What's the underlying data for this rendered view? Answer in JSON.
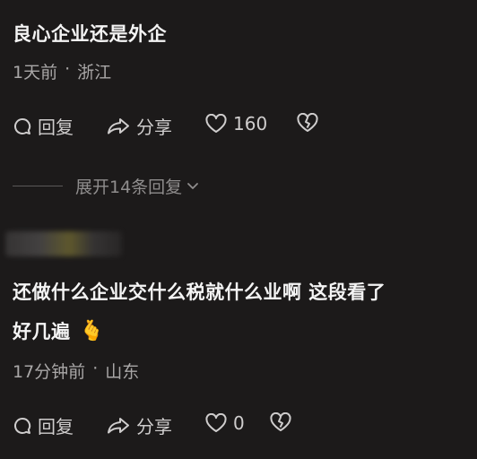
{
  "comment1": {
    "text": "良心企业还是外企",
    "time": "1天前",
    "separator": "·",
    "location": "浙江",
    "reply_label": "回复",
    "share_label": "分享",
    "like_count": "160"
  },
  "expand": {
    "label": "展开14条回复"
  },
  "comment2": {
    "text_line1": "还做什么企业交什么税就什么业啊 这段看了",
    "text_line2": "好几遍",
    "emoji": "🫰",
    "time": "17分钟前",
    "separator": "·",
    "location": "山东",
    "reply_label": "回复",
    "share_label": "分享",
    "like_count": "0"
  },
  "icons": {
    "reply": "speech-bubble-icon",
    "share": "share-arrow-icon",
    "like": "heart-icon",
    "dislike": "broken-heart-icon",
    "expand": "chevron-down-icon"
  },
  "colors": {
    "background": "#1c1a1a",
    "primary_text": "#f4f4f4",
    "secondary_text": "#a9a7a7",
    "icon": "#cfcdcd"
  }
}
